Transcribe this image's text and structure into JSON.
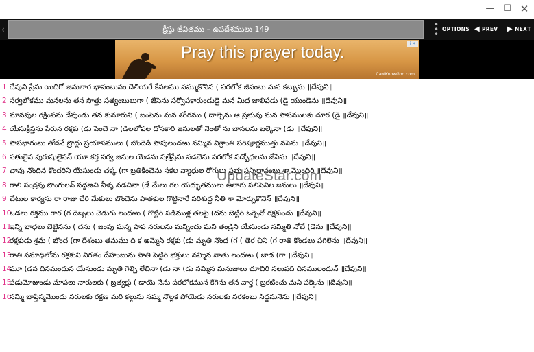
{
  "window": {
    "minimize_glyph": "—",
    "maximize_glyph": "☐",
    "close_glyph": "✕"
  },
  "toolbar": {
    "back_glyph": "‹",
    "title": "క్రీస్తు జీవితము – ఉపదేశములు 149",
    "options_label": "OPTIONS",
    "prev_label": "PREV",
    "next_label": "NEXT"
  },
  "ad": {
    "headline": "Pray this prayer today.",
    "url": "CanIKnowGod.com",
    "choices_glyph": "i ✕"
  },
  "watermark": "UpdateStar.com",
  "verses": [
    {
      "num": "1",
      "text": "దేవుని ప్రేమ యిదిగో జనులార భావంబునం దెలియరే కేవలము నమ్ముకొనిన ( పరలోక జీవంబు మన కబ్బును ",
      "tag": "॥దేవుని॥"
    },
    {
      "num": "2",
      "text": "సర్వలోకము మనలను తన సొత్తు సత్యంబులుగా ( జేసెను సర్వోపకారుండుడై మన మీద జాలిపడు (డై యుండెను ",
      "tag": "॥దేవుని॥"
    },
    {
      "num": "3",
      "text": "మానవుల రక్షింపను దేవుండు తన కుమారుని ( బంపెను మన శరీరము ( దాల్చెను ఆ ప్రభువు మన పాపములకు దూర (డై ",
      "tag": "॥దేవుని॥"
    },
    {
      "num": "4",
      "text": "యేసుక్రీస్తను పేరున రక్షకు (డు పెంచె నా (డిలలోపల దోసకారి జనులతో నెంతో ను బాసలను బల్కెనా (డు ",
      "tag": "॥దేవుని॥"
    },
    {
      "num": "5",
      "text": "పాపభారంబు తోడనే ప్రొద్దు ప్రయాసములు ( బొందెడి పాపులందఱు నమ్మిన విశ్రాంతి పరిపూర్ణముత్తు వసెను ",
      "tag": "॥దేవుని॥"
    },
    {
      "num": "6",
      "text": "సతులైన పురుషులైనన్ యూ కర్త సర్వ జనుల యెడను సత్రేప్రేమ నడచెను పరలోక సద్బోధలను జేసెను ",
      "tag": "॥దేవుని॥"
    },
    {
      "num": "7",
      "text": "చావు నొందిన కొందరిని యేసుండు చక్క (గా బ్రతికించెను సకల వ్యాధుల రోగులు ప్రభు సన్నిధానంబు శా మొందిరి ",
      "tag": "॥దేవుని॥"
    },
    {
      "num": "8",
      "text": "గాలి సంద్రపు పొంగులన్ సద్దణచి నీళ్ళ నడచినా (డే మేలు గల యద్భుతములు ఆలాగు సలిపెనిల జనులు ",
      "tag": "॥దేవుని॥"
    },
    {
      "num": "9",
      "text": "చేటుల కార్యను రా రాజు చేరి మేకులు బొందెను పాతకుల గొట్టినారే పరిశుద్ధ నీతి శా మోర్చుకొనెన్ ",
      "tag": "॥దేవుని॥"
    },
    {
      "num": "10",
      "text": "ఒడలు రక్తము గార (గ దెబ్బలు చెడుగు లందఱు ( గొట్టిరి పడిముళ్ల తలపై (దను బెట్టిరి ఓర్చెనో రక్షకుండు ",
      "tag": "॥దేవుని॥"
    },
    {
      "num": "11",
      "text": "ఇన్ని బాధలు బెట్టినను ( దను ( జంపు మన్న పాప నరులను మన్నించు మని తండ్రిని యేసుండు నమ్మితి నోచే (డెను ",
      "tag": "॥దేవుని॥"
    },
    {
      "num": "12",
      "text": "రక్షకుడు శ్రమ ( బొంద (గా దేశంబు తమము ది క ఱమ్మెన్ రక్షకు (డు మృతి నొంద (గ ( తెర చిని (గ రాతి కొండలు పగిలెను ",
      "tag": "॥దేవుని॥"
    },
    {
      "num": "13",
      "text": "రాతి సమాధిలోను రక్షకుని నిరతం దేహంబును పాతి పెట్టిరి భక్తులు నమ్మిన నాతు లందఱు ( జాడ (గా ",
      "tag": "॥దేవుని॥"
    },
    {
      "num": "14",
      "text": "మూ (డవ దినమందున యేసుండు మృతి గెల్చి లేచినా (డు నా (డు నమ్మిన మనుజులు చూచిరి నలువది దినములందున్ ",
      "tag": "॥దేవుని॥"
    },
    {
      "num": "15",
      "text": "పడుమోజుండు మాపలు నారులకు ( బ్రత్యక్షు ( డాయె నేను పరలోకమున కేగెను తన వార్త ( బ్రకటించు మని పక్కెను ",
      "tag": "॥దేవుని॥"
    },
    {
      "num": "16",
      "text": "నమ్మి బాప్తిస్మమొందు నరులకు రక్షణ మరి కల్గును నమ్మ నొల్లక పోయెడు నరులకు నరకంబు సిద్ధమనెను ",
      "tag": "॥దేవుని॥"
    }
  ]
}
